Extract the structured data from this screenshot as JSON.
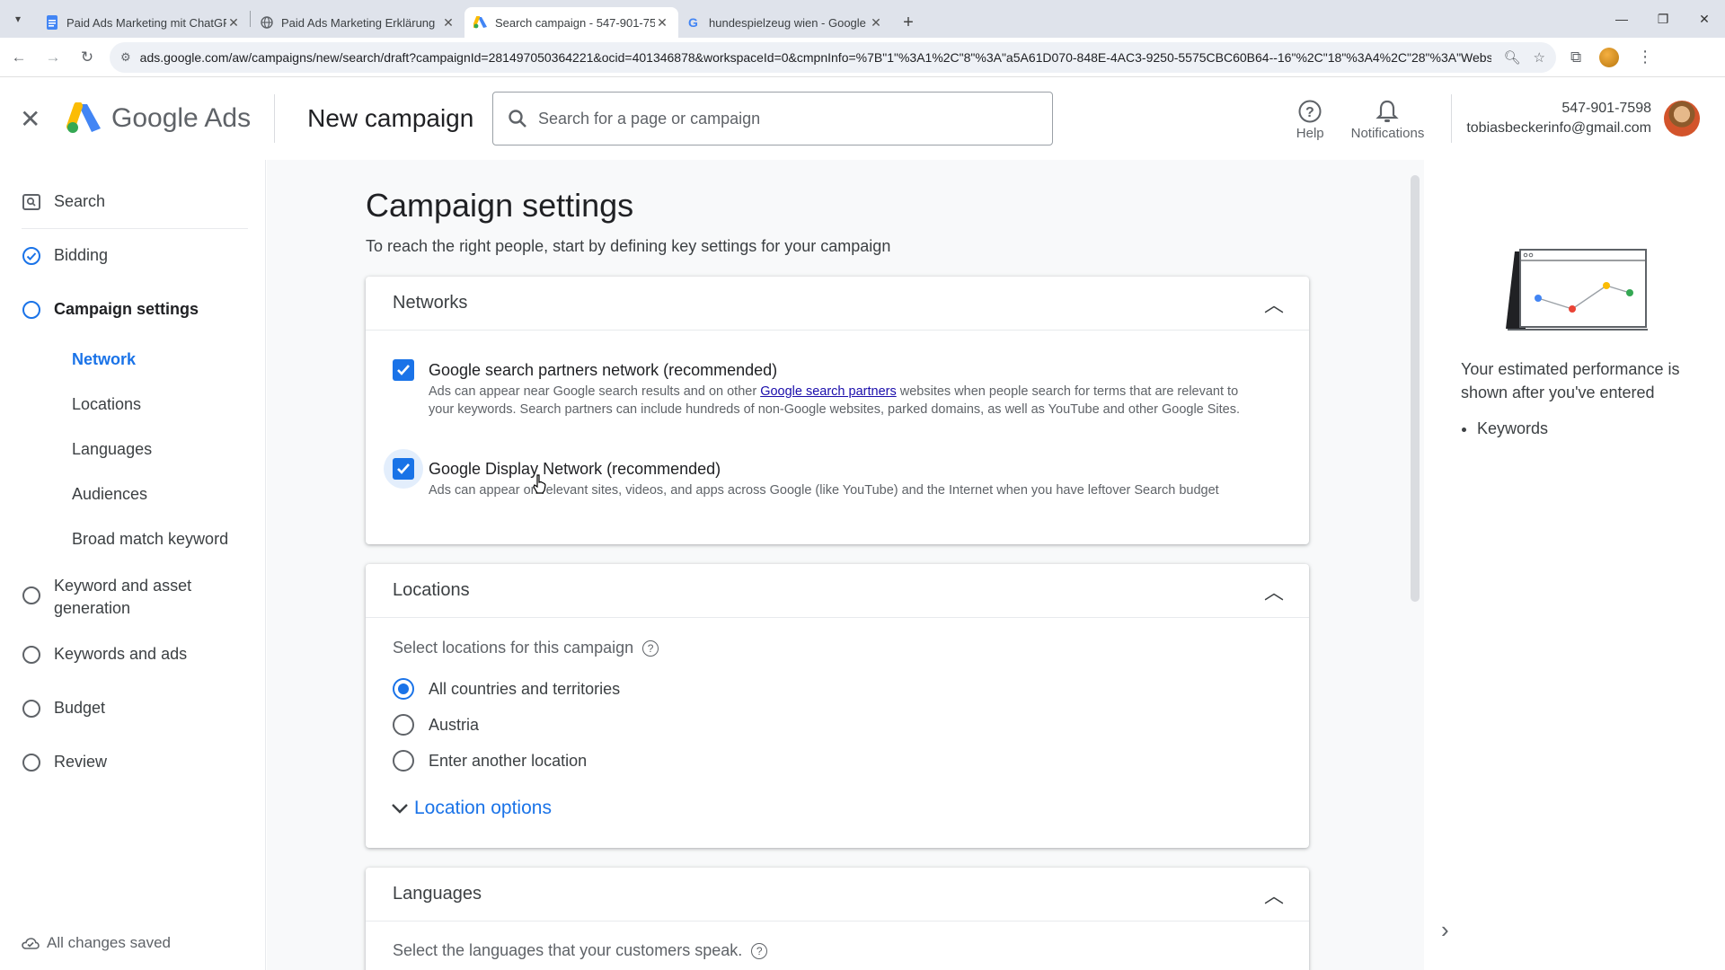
{
  "browser": {
    "tabs": [
      {
        "label": "Paid Ads Marketing mit ChatGPT",
        "icon": "docs-icon"
      },
      {
        "label": "Paid Ads Marketing Erklärung",
        "icon": "globe-icon"
      },
      {
        "label": "Search campaign - 547-901-75",
        "icon": "google-ads-icon"
      },
      {
        "label": "hundespielzeug wien - Google",
        "icon": "google-icon"
      }
    ],
    "url": "ads.google.com/aw/campaigns/new/search/draft?campaignId=281497050364221&ocid=401346878&workspaceId=0&cmpnInfo=%7B\"1\"%3A1%2C\"8\"%3A\"a5A61D070-848E-4AC3-9250-5575CBC60B64--16\"%2C\"18\"%3A4%2C\"28\"%3A\"Website+traf..."
  },
  "header": {
    "logo_text": "Google Ads",
    "title": "New campaign",
    "search_placeholder": "Search for a page or campaign",
    "help_label": "Help",
    "notifications_label": "Notifications",
    "account_id": "547-901-7598",
    "account_email": "tobiasbeckerinfo@gmail.com"
  },
  "sidebar": {
    "items": [
      {
        "label": "Search",
        "state": "search"
      },
      {
        "label": "Bidding",
        "state": "done"
      },
      {
        "label": "Campaign settings",
        "state": "active"
      },
      {
        "label": "Keyword and asset generation",
        "state": "todo"
      },
      {
        "label": "Keywords and ads",
        "state": "todo"
      },
      {
        "label": "Budget",
        "state": "todo"
      },
      {
        "label": "Review",
        "state": "todo"
      }
    ],
    "subitems": [
      "Network",
      "Locations",
      "Languages",
      "Audiences",
      "Broad match keyword"
    ],
    "saved_status": "All changes saved"
  },
  "main": {
    "title": "Campaign settings",
    "subtitle": "To reach the right people, start by defining key settings for your campaign",
    "networks": {
      "heading": "Networks",
      "search_partners_title": "Google search partners network (recommended)",
      "search_partners_desc_before": "Ads can appear near Google search results and on other ",
      "search_partners_link": "Google search partners",
      "search_partners_desc_after": " websites when people search for terms that are relevant to your keywords. Search partners can include hundreds of non-Google websites, parked domains, as well as YouTube and other Google Sites.",
      "display_title": "Google Display Network (recommended)",
      "display_desc": "Ads can appear on relevant sites, videos, and apps across Google (like YouTube) and the Internet when you have leftover Search budget"
    },
    "locations": {
      "heading": "Locations",
      "prompt": "Select locations for this campaign",
      "options": [
        "All countries and territories",
        "Austria",
        "Enter another location"
      ],
      "selected": "All countries and territories",
      "more_link": "Location options"
    },
    "languages": {
      "heading": "Languages",
      "prompt": "Select the languages that your customers speak."
    }
  },
  "right_panel": {
    "text": "Your estimated performance is shown after you've entered",
    "bullets": [
      "Keywords"
    ]
  },
  "colors": {
    "accent": "#1a73e8",
    "link": "#1a0dab"
  }
}
